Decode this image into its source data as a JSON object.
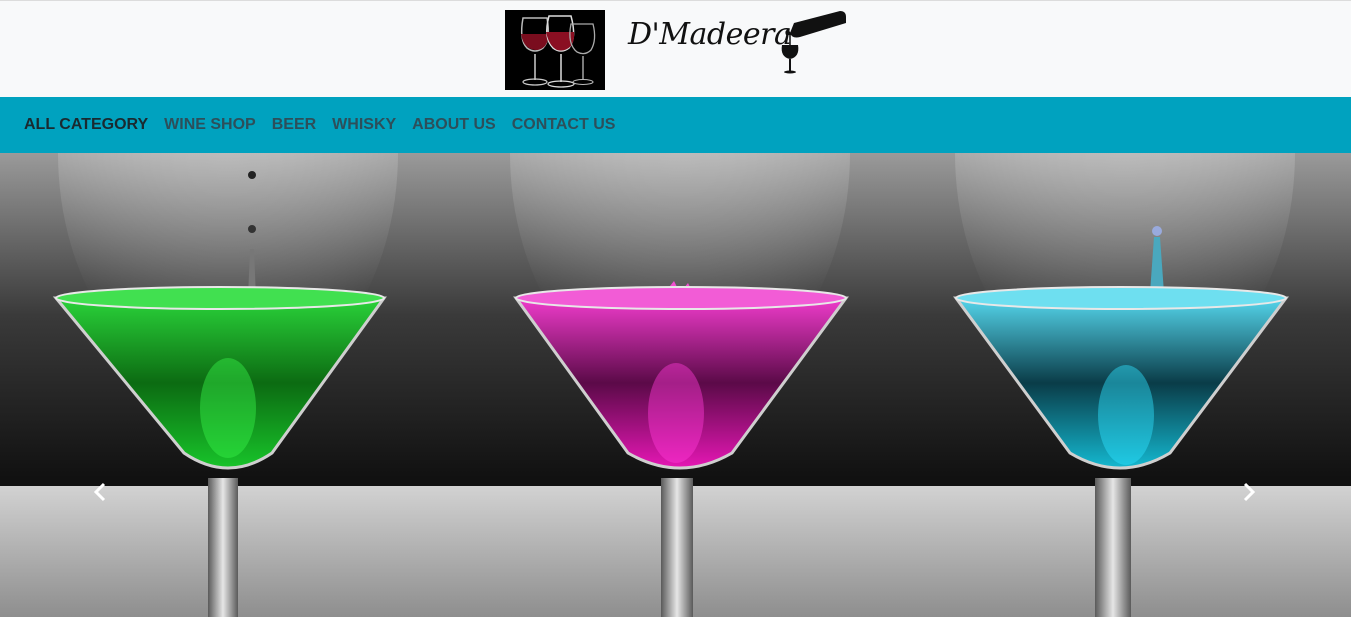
{
  "brand": {
    "name": "D'Madeera"
  },
  "nav": {
    "items": [
      {
        "label": "ALL CATEGORY",
        "active": true
      },
      {
        "label": "WINE SHOP"
      },
      {
        "label": "BEER"
      },
      {
        "label": "WHISKY"
      },
      {
        "label": "ABOUT US"
      },
      {
        "label": "CONTACT US"
      }
    ]
  },
  "colors": {
    "navbar": "#00a2bf",
    "header": "#f8f9fa",
    "nav_text": "#2d4f5a",
    "drink_green": "#12c81e",
    "drink_magenta": "#e617b4",
    "drink_cyan": "#0fb9d2"
  },
  "carousel": {
    "prev_icon": "chevron-left-icon",
    "next_icon": "chevron-right-icon"
  }
}
